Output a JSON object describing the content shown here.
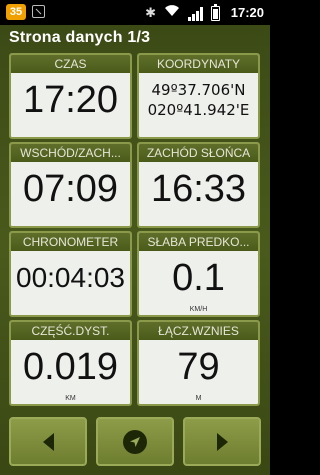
{
  "statusbar": {
    "badge": "35",
    "time": "17:20",
    "icons": [
      "notification-icon",
      "mute-icon",
      "wifi-icon",
      "signal-icon",
      "battery-icon"
    ]
  },
  "page_title": "Strona danych 1/3",
  "fields": [
    {
      "label": "CZAS",
      "value": "17:20",
      "unit": ""
    },
    {
      "label": "KOORDYNATY",
      "lat": "49º37.706'N",
      "lon": "020º41.942'E"
    },
    {
      "label": "WSCHÓD/ZACH...",
      "value": "07:09",
      "unit": ""
    },
    {
      "label": "ZACHÓD SŁOŃCA",
      "value": "16:33",
      "unit": ""
    },
    {
      "label": "CHRONOMETER",
      "value": "00:04:03",
      "unit": ""
    },
    {
      "label": "SŁABA PREDKO...",
      "value": "0.1",
      "unit": "KM/H"
    },
    {
      "label": "CZĘŚĆ.DYST.",
      "value": "0.019",
      "unit": "KM"
    },
    {
      "label": "ŁĄCZ.WZNIES",
      "value": "79",
      "unit": "M"
    }
  ],
  "nav": {
    "prev_icon": "arrow-left-icon",
    "center_icon": "navigate-icon",
    "next_icon": "arrow-right-icon"
  },
  "colors": {
    "background": "#3c4a16",
    "cell_bg": "#eef0ec",
    "cell_header": "#5f6f2a",
    "button": "#8c9c48"
  }
}
